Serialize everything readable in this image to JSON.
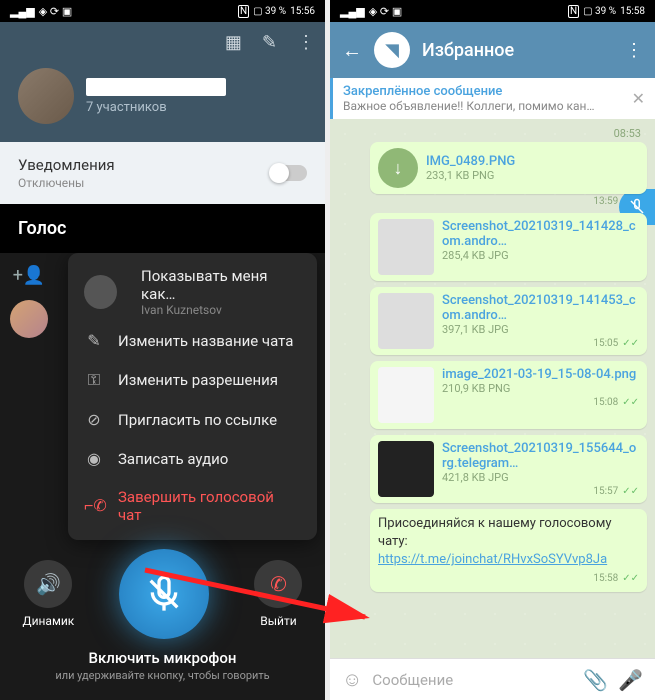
{
  "status": {
    "left_icons": "◈ ⟳ ▣",
    "nfc": "N",
    "battery": "▢ 39 %",
    "time1": "15:56",
    "time2": "15:58"
  },
  "phone1": {
    "group_sub": "7 участников",
    "notif_label": "Уведомления",
    "notif_sub": "Отключены",
    "section_title": "Голос",
    "menu": {
      "header_title": "Показывать меня как…",
      "header_sub": "Ivan Kuznetsov",
      "edit": "Изменить название чата",
      "perms": "Изменить разрешения",
      "invite": "Пригласить по ссылке",
      "record": "Записать аудио",
      "end": "Завершить голосовой чат"
    },
    "controls": {
      "speaker": "Динамик",
      "leave": "Выйти",
      "hint_title": "Включить микрофон",
      "hint_sub": "или удерживайте кнопку, чтобы говорить"
    }
  },
  "phone2": {
    "title": "Избранное",
    "pinned_title": "Закреплённое сообщение",
    "pinned_sub": "Важное объявление!! Коллеги, помимо кан…",
    "msgs": [
      {
        "type": "time",
        "t": "08:53"
      },
      {
        "type": "file",
        "name": "IMG_0489.PNG",
        "meta": "233,1 KB PNG",
        "time": "13:59"
      },
      {
        "type": "img",
        "name": "Screenshot_20210319_141428_com.andro…",
        "meta": "285,4 KB JPG",
        "time": ""
      },
      {
        "type": "img",
        "name": "Screenshot_20210319_141453_com.andro…",
        "meta": "397,1 KB JPG",
        "time": "15:05"
      },
      {
        "type": "img",
        "name": "image_2021-03-19_15-08-04.png",
        "meta": "210,9 KB PNG",
        "time": "15:08"
      },
      {
        "type": "img",
        "name": "Screenshot_20210319_155644_org.telegram…",
        "meta": "421,8 KB JPG",
        "time": "15:57"
      }
    ],
    "text_msg": "Присоединяйся к нашему голосовому чату: ",
    "text_link": "https://t.me/joinchat/RHvxSoSYVvp8Ja",
    "text_time": "15:58",
    "input_placeholder": "Сообщение"
  }
}
